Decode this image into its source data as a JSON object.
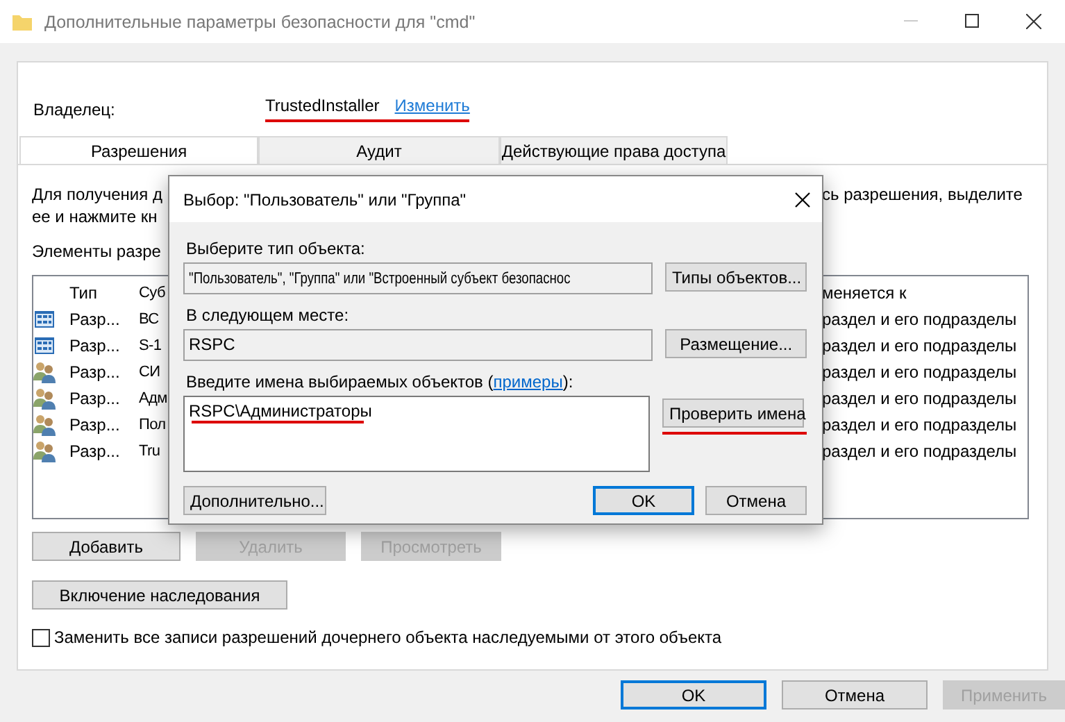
{
  "window": {
    "title": "Дополнительные параметры безопасности  для \"cmd\""
  },
  "owner": {
    "label": "Владелец:",
    "value": "TrustedInstaller",
    "link": "Изменить"
  },
  "tabs": [
    {
      "label": "Разрешения",
      "selected": true
    },
    {
      "label": "Аудит",
      "selected": false
    },
    {
      "label": "Действующие права доступа",
      "selected": false
    }
  ],
  "intro": {
    "line_1_left": "Для получения д",
    "line_1_right": "сь разрешения, выделите",
    "line_2_left": "ее и нажмите кн"
  },
  "list_label": "Элементы разре",
  "permissions": {
    "columns": [
      "Тип",
      "Суб",
      "меняется к"
    ],
    "rows": [
      {
        "kind": "package",
        "type": "Разр...",
        "subject": "ВС",
        "applies_to": "раздел и его подразделы"
      },
      {
        "kind": "package",
        "type": "Разр...",
        "subject": "S-1",
        "applies_to": "раздел и его подразделы"
      },
      {
        "kind": "group",
        "type": "Разр...",
        "subject": "СИ",
        "applies_to": "раздел и его подразделы"
      },
      {
        "kind": "group",
        "type": "Разр...",
        "subject": "Адм",
        "applies_to": "раздел и его подразделы"
      },
      {
        "kind": "group",
        "type": "Разр...",
        "subject": "Пол",
        "applies_to": "раздел и его подразделы"
      },
      {
        "kind": "group",
        "type": "Разр...",
        "subject": "Tru",
        "applies_to": "раздел и его подразделы"
      }
    ]
  },
  "buttons": [
    {
      "label": "Добавить",
      "disabled": false
    },
    {
      "label": "Удалить",
      "disabled": true
    },
    {
      "label": "Просмотреть",
      "disabled": true
    }
  ],
  "inherit_button": {
    "label": "Включение наследования",
    "disabled": false
  },
  "replace_checkbox": {
    "label": "Заменить все записи разрешений дочернего объекта наследуемыми от этого объекта",
    "checked": false
  },
  "footer_buttons": [
    {
      "label": "OK",
      "default": true,
      "disabled": false
    },
    {
      "label": "Отмена",
      "default": false,
      "disabled": false
    },
    {
      "label": "Применить",
      "default": false,
      "disabled": true
    }
  ],
  "dialog": {
    "title": "Выбор: \"Пользователь\" или \"Группа\"",
    "object_type": {
      "label": "Выберите тип объекта:",
      "value": "\"Пользователь\", \"Группа\" или \"Встроенный субъект безопаснос",
      "button": "Типы объектов..."
    },
    "location": {
      "label": "В следующем месте:",
      "value": "RSPC",
      "button": "Размещение..."
    },
    "names": {
      "label": "Введите имена выбираемых объектов (",
      "link": "примеры",
      "label_end": "):",
      "value": "RSPC\\Администраторы",
      "button": "Проверить имена"
    },
    "advanced_button": {
      "label": "Дополнительно...",
      "default": false,
      "disabled": false
    },
    "ok_button": {
      "label": "OK",
      "default": true,
      "disabled": false
    },
    "cancel_button": {
      "label": "Отмена",
      "default": false,
      "disabled": false
    }
  }
}
